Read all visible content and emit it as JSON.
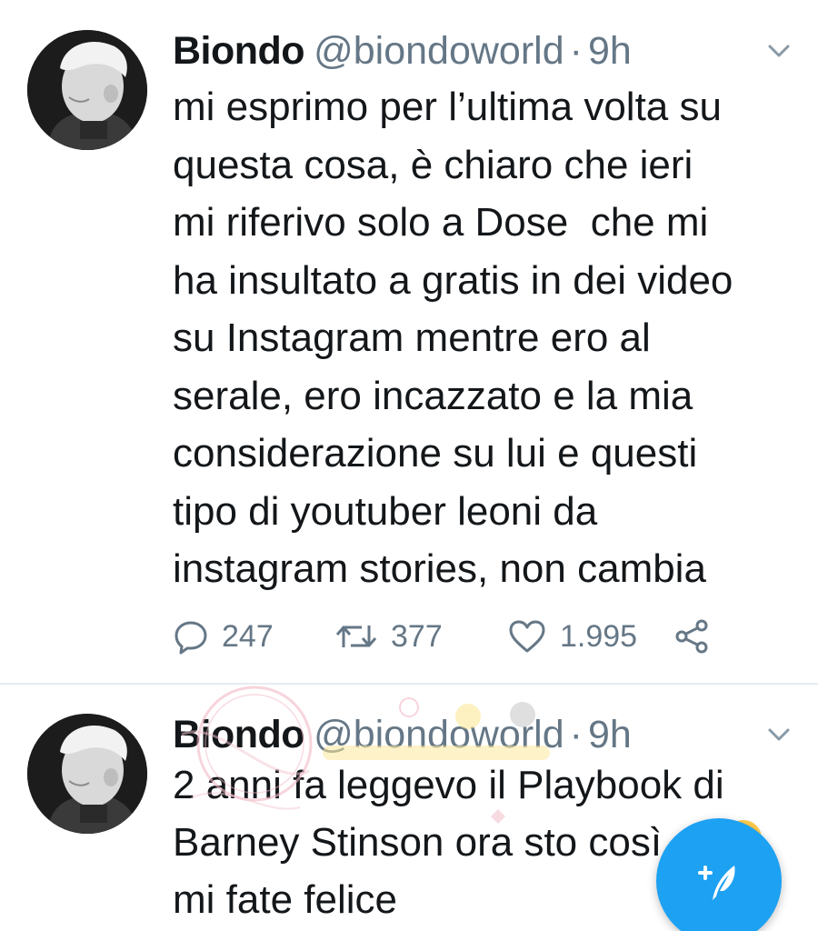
{
  "tweets": [
    {
      "author_name": "Biondo",
      "handle": "@biondoworld",
      "separator": "·",
      "time": "9h",
      "text_lines": [
        "mi esprimo per l’ultima volta su",
        "questa cosa, è chiaro che ieri",
        "mi riferivo solo a Dose  che mi",
        "ha insultato a gratis in dei video",
        "su Instagram mentre ero al",
        "serale, ero incazzato e la mia",
        "considerazione su lui e questi",
        "tipo di youtuber leoni da",
        "instagram stories, non cambia"
      ],
      "replies": "247",
      "retweets": "377",
      "likes": "1.995"
    },
    {
      "author_name": "Biondo",
      "handle": "@biondoworld",
      "separator": "·",
      "time": "9h",
      "text_lines": [
        "2 anni fa leggevo il Playbook di",
        "Barney Stinson ora sto così",
        "mi fate felice"
      ]
    }
  ],
  "icons": {
    "reply": "reply-icon",
    "retweet": "retweet-icon",
    "like": "heart-icon",
    "share": "share-icon",
    "menu": "chevron-down-icon",
    "compose": "compose-tweet-icon"
  },
  "colors": {
    "accent": "#1da1f2",
    "secondary_text": "#657786",
    "primary_text": "#14171a",
    "divider": "#e6ecf0"
  }
}
